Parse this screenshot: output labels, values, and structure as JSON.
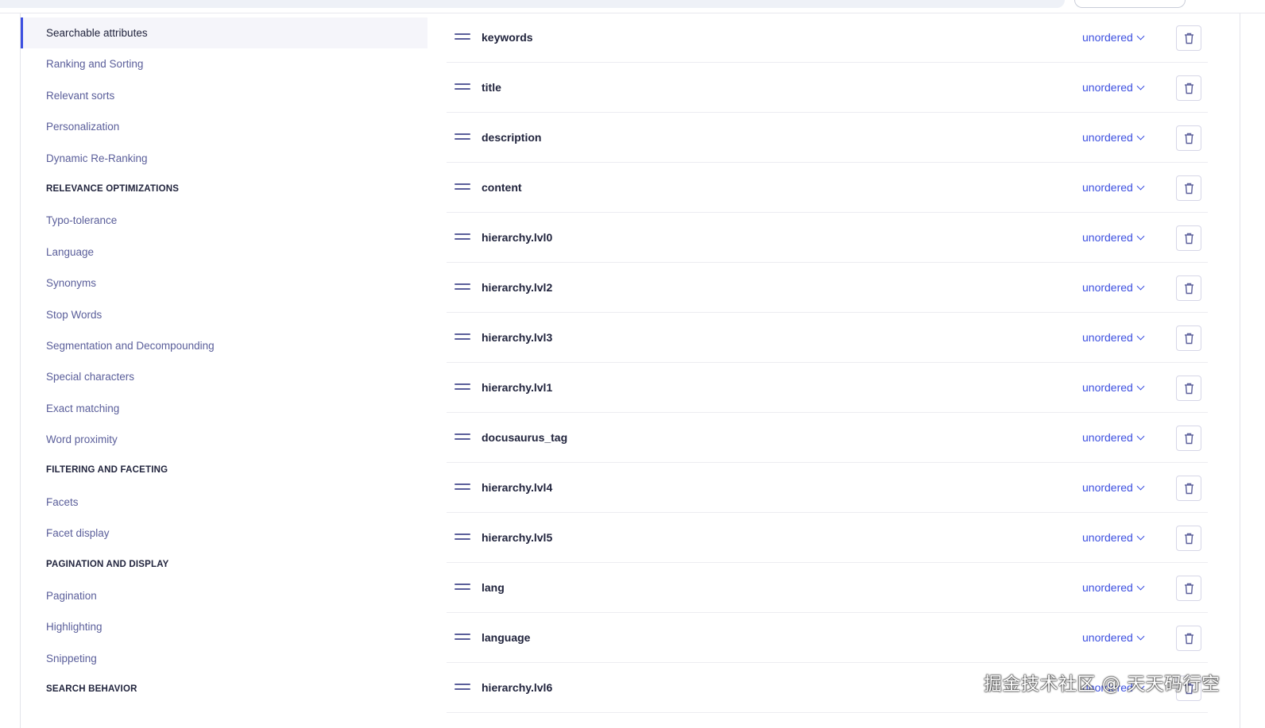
{
  "sidebar": {
    "items": [
      {
        "type": "item",
        "label": "Searchable attributes",
        "active": true
      },
      {
        "type": "item",
        "label": "Ranking and Sorting"
      },
      {
        "type": "item",
        "label": "Relevant sorts"
      },
      {
        "type": "item",
        "label": "Personalization"
      },
      {
        "type": "item",
        "label": "Dynamic Re-Ranking"
      },
      {
        "type": "heading",
        "label": "RELEVANCE OPTIMIZATIONS"
      },
      {
        "type": "item",
        "label": "Typo-tolerance"
      },
      {
        "type": "item",
        "label": "Language"
      },
      {
        "type": "item",
        "label": "Synonyms"
      },
      {
        "type": "item",
        "label": "Stop Words"
      },
      {
        "type": "item",
        "label": "Segmentation and Decompounding"
      },
      {
        "type": "item",
        "label": "Special characters"
      },
      {
        "type": "item",
        "label": "Exact matching"
      },
      {
        "type": "item",
        "label": "Word proximity"
      },
      {
        "type": "heading",
        "label": "FILTERING AND FACETING"
      },
      {
        "type": "item",
        "label": "Facets"
      },
      {
        "type": "item",
        "label": "Facet display"
      },
      {
        "type": "heading",
        "label": "PAGINATION AND DISPLAY"
      },
      {
        "type": "item",
        "label": "Pagination"
      },
      {
        "type": "item",
        "label": "Highlighting"
      },
      {
        "type": "item",
        "label": "Snippeting"
      },
      {
        "type": "heading",
        "label": "SEARCH BEHAVIOR"
      }
    ]
  },
  "attributes": [
    {
      "name": "keywords",
      "order": "unordered"
    },
    {
      "name": "title",
      "order": "unordered"
    },
    {
      "name": "description",
      "order": "unordered"
    },
    {
      "name": "content",
      "order": "unordered"
    },
    {
      "name": "hierarchy.lvl0",
      "order": "unordered"
    },
    {
      "name": "hierarchy.lvl2",
      "order": "unordered"
    },
    {
      "name": "hierarchy.lvl3",
      "order": "unordered"
    },
    {
      "name": "hierarchy.lvl1",
      "order": "unordered"
    },
    {
      "name": "docusaurus_tag",
      "order": "unordered"
    },
    {
      "name": "hierarchy.lvl4",
      "order": "unordered"
    },
    {
      "name": "hierarchy.lvl5",
      "order": "unordered"
    },
    {
      "name": "lang",
      "order": "unordered"
    },
    {
      "name": "language",
      "order": "unordered"
    },
    {
      "name": "hierarchy.lvl6",
      "order": "unordered"
    }
  ],
  "icons": {
    "drag": "drag-handle-icon",
    "chevron": "chevron-down-icon",
    "delete": "trash-icon"
  },
  "watermark": "掘金技术社区 @ 天天码行空",
  "colors": {
    "accent": "#3c4fe0",
    "sidebar_text": "#5a5e9a",
    "active_bg": "#f5f5fa"
  }
}
